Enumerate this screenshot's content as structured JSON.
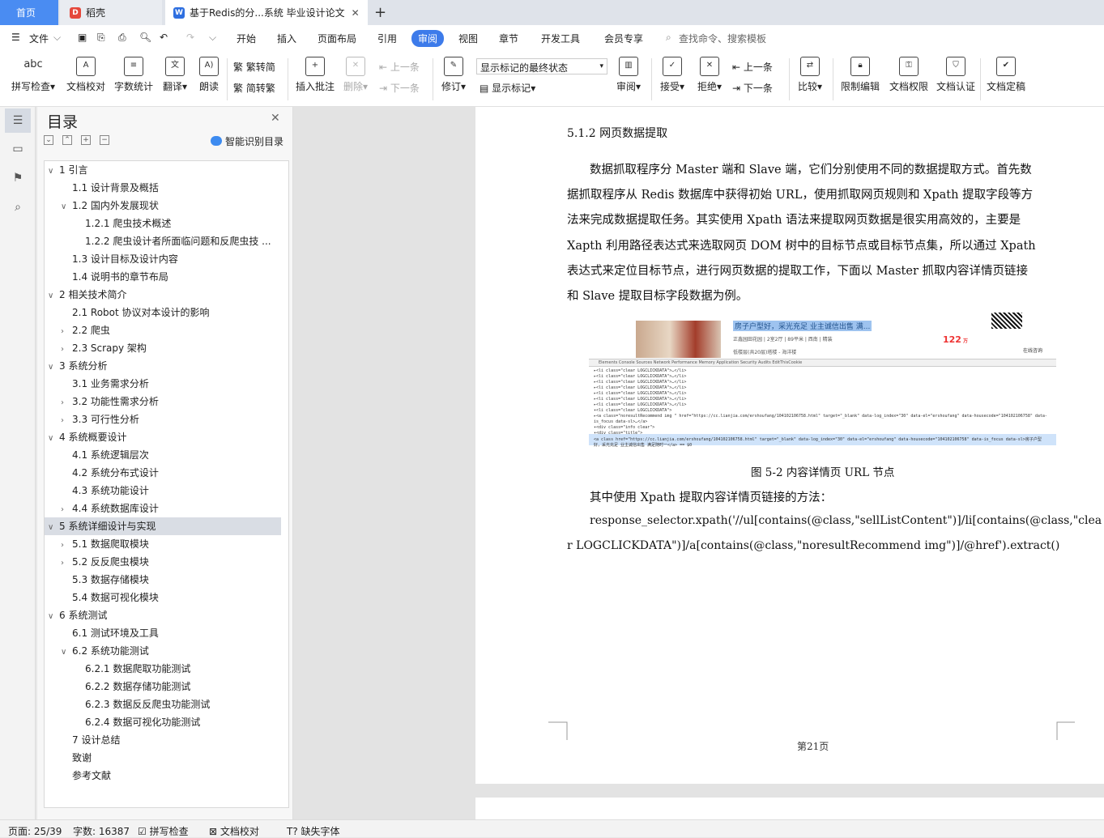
{
  "tabs": {
    "home": "首页",
    "daoke": "稻壳",
    "doc": "基于Redis的分...系统 毕业设计论文",
    "add": "+",
    "close": "✕"
  },
  "menu": {
    "file": "文件",
    "items": [
      "开始",
      "插入",
      "页面布局",
      "引用",
      "审阅",
      "视图",
      "章节",
      "开发工具",
      "会员专享"
    ],
    "search": "查找命令、搜索模板"
  },
  "ribbon": {
    "spell": "拼写检查",
    "proofread": "文档校对",
    "wordcount": "字数统计",
    "translate": "翻译",
    "read": "朗读",
    "trad": "繁转简",
    "simp": "简转繁",
    "insert_comment": "插入批注",
    "delete": "删除",
    "prev_comment": "上一条",
    "next_comment": "下一条",
    "revise": "修订",
    "markup_select": "显示标记的最终状态",
    "show_markup": "显示标记",
    "review": "审阅",
    "accept": "接受",
    "reject": "拒绝",
    "prev": "上一条",
    "next": "下一条",
    "compare": "比较",
    "restrict": "限制编辑",
    "permission": "文档权限",
    "certify": "文档认证",
    "finalize": "文档定稿",
    "abc": "abc"
  },
  "toc": {
    "title": "目录",
    "ai_label": "智能识别目录",
    "items": [
      {
        "label": "1  引言",
        "arrow": "∨"
      },
      {
        "label": "1.1  设计背景及概括",
        "arrow": ""
      },
      {
        "label": "1.2  国内外发展现状",
        "arrow": "∨"
      },
      {
        "label": "1.2.1  爬虫技术概述",
        "arrow": ""
      },
      {
        "label": "1.2.2  爬虫设计者所面临问题和反爬虫技 ...",
        "arrow": ""
      },
      {
        "label": "1.3  设计目标及设计内容",
        "arrow": ""
      },
      {
        "label": "1.4  说明书的章节布局",
        "arrow": ""
      },
      {
        "label": "2  相关技术简介",
        "arrow": "∨"
      },
      {
        "label": "2.1 Robot 协议对本设计的影响",
        "arrow": ""
      },
      {
        "label": "2.2  爬虫",
        "arrow": "›"
      },
      {
        "label": "2.3 Scrapy 架构",
        "arrow": "›"
      },
      {
        "label": "3  系统分析",
        "arrow": "∨"
      },
      {
        "label": "3.1  业务需求分析",
        "arrow": ""
      },
      {
        "label": "3.2  功能性需求分析",
        "arrow": "›"
      },
      {
        "label": "3.3  可行性分析",
        "arrow": "›"
      },
      {
        "label": "4  系统概要设计",
        "arrow": "∨"
      },
      {
        "label": "4.1  系统逻辑层次",
        "arrow": ""
      },
      {
        "label": "4.2  系统分布式设计",
        "arrow": ""
      },
      {
        "label": "4.3  系统功能设计",
        "arrow": ""
      },
      {
        "label": "4.4  系统数据库设计",
        "arrow": "›"
      },
      {
        "label": "5  系统详细设计与实现",
        "arrow": "∨"
      },
      {
        "label": "5.1  数据爬取模块",
        "arrow": "›"
      },
      {
        "label": "5.2  反反爬虫模块",
        "arrow": "›"
      },
      {
        "label": "5.3  数据存储模块",
        "arrow": ""
      },
      {
        "label": "5.4  数据可视化模块",
        "arrow": ""
      },
      {
        "label": "6  系统测试",
        "arrow": "∨"
      },
      {
        "label": "6.1  测试环境及工具",
        "arrow": ""
      },
      {
        "label": "6.2  系统功能测试",
        "arrow": "∨"
      },
      {
        "label": "6.2.1  数据爬取功能测试",
        "arrow": ""
      },
      {
        "label": "6.2.2  数据存储功能测试",
        "arrow": ""
      },
      {
        "label": "6.2.3  数据反反爬虫功能测试",
        "arrow": ""
      },
      {
        "label": "6.2.4  数据可视化功能测试",
        "arrow": ""
      },
      {
        "label": "7  设计总结",
        "arrow": ""
      },
      {
        "label": "致谢",
        "arrow": ""
      },
      {
        "label": "参考文献",
        "arrow": ""
      }
    ]
  },
  "doc": {
    "heading": "5.1.2  网页数据提取",
    "lines": [
      "数据抓取程序分 Master 端和 Slave 端，它们分别使用不同的数据提取方式。首先数",
      "据抓取程序从 Redis 数据库中获得初始 URL，使用抓取网页规则和 Xpath 提取字段等方",
      "法来完成数据提取任务。其实使用 Xpath 语法来提取网页数据是很实用高效的，主要是",
      "Xapth 利用路径表达式来选取网页 DOM 树中的目标节点或目标节点集，所以通过 Xpath",
      "表达式来定位目标节点，进行网页数据的提取工作，下面以 Master 抓取内容详情页链接",
      "和 Slave 提取目标字段数据为例。"
    ],
    "figure": {
      "title": "房子户型好，采光充足 业主诚信出售 满...",
      "sub": "正鑫园田花园 | 2室2厅 | 89平米 | 西南 | 精装",
      "sub2": "低楼层(共20层)塔楼 - 海洋楼",
      "price": "122",
      "price_unit": "万",
      "consult": "在线咨询",
      "devtabs": "Elements   Console   Sources   Network   Performance   Memory   Application   Security   Audits   EditThisCookie",
      "code": [
        "▸<li class=\"clear LOGCLICKDATA\">…</li>",
        "▸<li class=\"clear LOGCLICKDATA\">…</li>",
        "▸<li class=\"clear LOGCLICKDATA\">…</li>",
        "▸<li class=\"clear LOGCLICKDATA\">…</li>",
        "▸<li class=\"clear LOGCLICKDATA\">…</li>",
        "▸<li class=\"clear LOGCLICKDATA\">…</li>",
        "▸<li class=\"clear LOGCLICKDATA\">…</li>",
        "▾<li class=\"clear LOGCLICKDATA\">",
        "  ▸<a class=\"noresultRecommend img \" href=\"https://cc.lianjia.com/ershoufang/104102106758.html\" target=\"_blank\" data-log_index=\"30\" data-el=\"ershoufang\" data-housecode=\"104102106758\" data-",
        "    is_focus data-sl>…</a>",
        "  ▾<div class=\"info clear\">",
        "    ▾<div class=\"title\">",
        "      <a class href=\"https://cc.lianjia.com/ershoufang/104102106758.html\" target=\"_blank\" data-log_index=\"30\" data-el=\"ershoufang\" data-housecode=\"104102106758\" data-is_focus data-sl>房子户型",
        "      好，采光充足 业主诚信出售 满足随时一</a> == $0"
      ]
    },
    "caption": "图 5-2  内容详情页 URL 节点",
    "line2": "其中使用 Xpath 提取内容详情页链接的方法：",
    "code1": "response_selector.xpath('//ul[contains(@class,\"sellListContent\")]/li[contains(@class,\"clea",
    "code2": "r LOGCLICKDATA\")]/a[contains(@class,\"noresultRecommend img\")]/@href').extract()",
    "page_num": "第21页"
  },
  "status": {
    "page": "页面: 25/39",
    "words": "字数: 16387",
    "spell": "拼写检查",
    "proof": "文档校对",
    "font": "缺失字体"
  },
  "colors": {
    "accent": "#3d7bea",
    "home_tab": "#4a8cf2",
    "selected_row": "#d9dde4"
  }
}
